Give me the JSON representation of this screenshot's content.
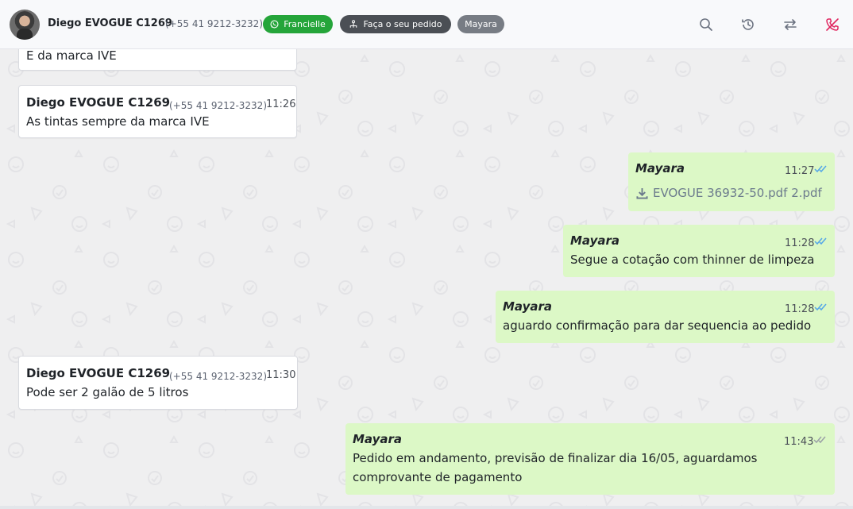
{
  "header": {
    "contact_name": "Diego EVOGUE C1269",
    "contact_phone": "(+55 41 9212-3232)",
    "tags": [
      {
        "label": "Francielle",
        "icon": "whatsapp-icon",
        "color": "#25a53a"
      },
      {
        "label": "Faça o seu pedido",
        "icon": "flow-icon",
        "color": "#4b4f55"
      },
      {
        "label": "Mayara",
        "color": "#777c84"
      }
    ],
    "actions": [
      "search-icon",
      "history-icon",
      "transfer-icon",
      "end-call-icon"
    ]
  },
  "messages": [
    {
      "direction": "in",
      "text": "E da marca IVE"
    },
    {
      "direction": "in",
      "sender": "Diego EVOGUE C1269",
      "phone": "(+55 41 9212-3232)",
      "time": "11:26",
      "text": "As tintas sempre da marca IVE"
    },
    {
      "direction": "out",
      "sender": "Mayara",
      "time": "11:27",
      "status": "read",
      "attachment": "EVOGUE 36932-50.pdf 2.pdf"
    },
    {
      "direction": "out",
      "sender": "Mayara",
      "time": "11:28",
      "status": "read",
      "text": "Segue a cotação com thinner de limpeza"
    },
    {
      "direction": "out",
      "sender": "Mayara",
      "time": "11:28",
      "status": "read",
      "text": "aguardo confirmação para dar sequencia ao pedido"
    },
    {
      "direction": "in",
      "sender": "Diego EVOGUE C1269",
      "phone": "(+55 41 9212-3232)",
      "time": "11:30",
      "text": "Pode ser 2 galão de 5 litros"
    },
    {
      "direction": "out",
      "sender": "Mayara",
      "time": "11:43",
      "status": "delivered",
      "text_lines": [
        "Pedido em andamento, previsão de finalizar dia 16/05, aguardamos",
        "comprovante de pagamento"
      ]
    }
  ],
  "colors": {
    "outgoing_bubble": "#dcf8c6",
    "incoming_bubble": "#ffffff",
    "read_ticks": "#53a6e8",
    "delivered_ticks": "#9aa0a6",
    "end_call": "#e0245e"
  }
}
